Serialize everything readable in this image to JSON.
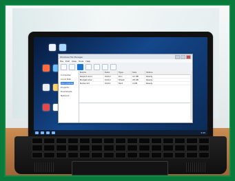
{
  "app": {
    "title": "Windows File Manager",
    "menu": [
      "File",
      "Edit",
      "View",
      "Tools",
      "Help"
    ]
  },
  "tree": {
    "items": [
      "Computer",
      "Local Disk",
      "Documents",
      "Projects",
      "Downloads",
      "Network"
    ]
  },
  "table": {
    "headers": [
      "Name",
      "Date",
      "Type",
      "Size",
      "Status"
    ],
    "rows": [
      [
        "Report.docx",
        "04/12",
        "Doc",
        "12 KB",
        "Ready"
      ],
      [
        "Budget.xlsx",
        "04/12",
        "Sheet",
        "28 KB",
        "Ready"
      ],
      [
        "Notes.txt",
        "04/11",
        "Text",
        "4 KB",
        "Ready"
      ]
    ]
  },
  "taskbar": {
    "time": "3:45"
  }
}
